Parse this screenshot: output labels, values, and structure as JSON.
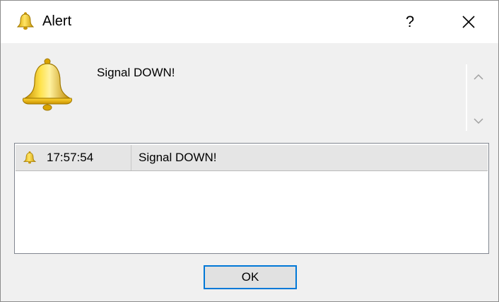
{
  "window": {
    "title": "Alert",
    "help_label": "?",
    "icon": "bell-icon"
  },
  "alert": {
    "icon": "bell-icon",
    "message": "Signal DOWN!"
  },
  "history": {
    "rows": [
      {
        "icon": "bell-icon",
        "time": "17:57:54",
        "message": "Signal DOWN!"
      }
    ]
  },
  "buttons": {
    "ok_label": "OK"
  },
  "colors": {
    "bell": "#f5c400",
    "bell_outline": "#b08000",
    "focus_border": "#0078d7",
    "row_background": "#e5e5e5"
  }
}
